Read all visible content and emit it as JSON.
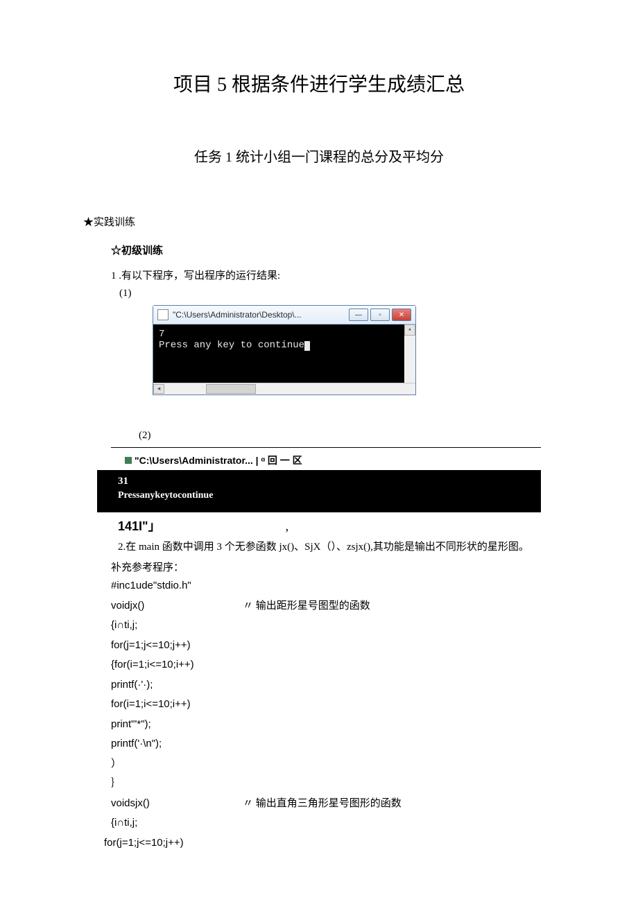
{
  "title": "项目 5 根据条件进行学生成绩汇总",
  "subtitle": "任务 1 统计小组一门课程的总分及平均分",
  "section_head": "★实践训练",
  "subsection": "☆初级训练",
  "item1": "1 .有以下程序，写出程序的运行结果:",
  "sub1": "(1)",
  "win1": {
    "title": "\"C:\\Users\\Administrator\\Desktop\\...",
    "line1": "   7",
    "line2": "Press any key to continue"
  },
  "sub2": "(2)",
  "win2_title": "\"C:\\Users\\Administrator... | ᵅ 回 一 区",
  "black": {
    "line1": "31",
    "line2": "Pressanykeytocontinue"
  },
  "foot": "141I\"」",
  "foot_comma": ",",
  "para": "2.在 main 函数中调用 3 个无参函数  jx()、SjX（）、zsjx(),其功能是输出不同形状的星形图。",
  "para2": "补充参考程序：",
  "code": {
    "l1": "#inc1ude\"stdio.h\"",
    "l2a": "voidjx()",
    "l2b": "〃 输出距形星号图型的函数",
    "l3": "{i∩ti,j;",
    "l4": "for(j=1;j<=10;j++)",
    "l5": "{for(i=1;i<=10;i++)",
    "l6": "printf(·'·);",
    "l7": "for(i=1;i<=10;i++)",
    "l8": "print\"'*\");",
    "l9": "printf('·\\n\");",
    "l10": "）",
    "l11": "｝",
    "l12a": "voidsjx()",
    "l12b": "〃 输出直角三角形星号图形的函数",
    "l13": "{i∩ti,j;",
    "l14": "for(j=1;j<=10;j++)"
  }
}
